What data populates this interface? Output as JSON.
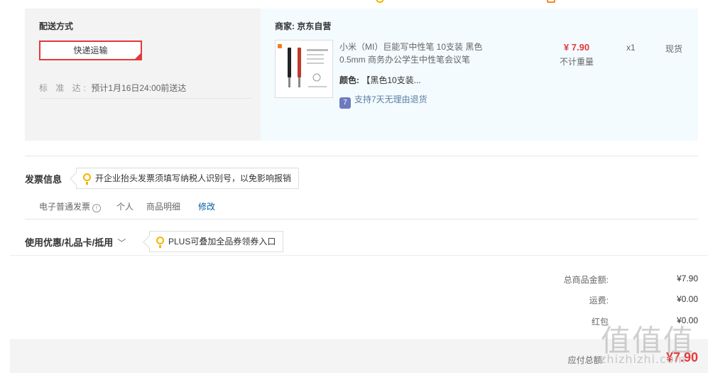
{
  "shipping": {
    "section_title": "配送方式",
    "express_label": "快递运输",
    "standard_label": "标 准 达:",
    "standard_eta": "预计1月16日24:00前送达"
  },
  "merchant": {
    "label": "商家:",
    "name": "京东自营"
  },
  "product": {
    "name": "小米（MI）巨能写中性笔 10支装 黑色0.5mm 商务办公学生中性笔会议笔",
    "color_label": "颜色:",
    "color_value": "【黑色10支装...",
    "return_badge": "7",
    "return_policy": "支持7天无理由退货",
    "price": "¥ 7.90",
    "weight": "不计重量",
    "qty": "x1",
    "stock": "现货"
  },
  "invoice": {
    "title": "发票信息",
    "tip": "开企业抬头发票须填写纳税人识别号，以免影响报销",
    "type": "电子普通发票",
    "info_icon": "info-circle-icon",
    "holder": "个人",
    "content": "商品明细",
    "edit": "修改"
  },
  "coupon": {
    "title": "使用优惠/礼品卡/抵用",
    "tip": "PLUS可叠加全品券领券入口"
  },
  "totals": {
    "goods_label": "总商品金额:",
    "goods_value": "¥7.90",
    "freight_label": "运费:",
    "freight_value": "¥0.00",
    "redpacket_label": "红包",
    "redpacket_value": "¥0.00",
    "payable_label": "应付总额:",
    "payable_value": "¥7.90"
  },
  "watermark": {
    "logo": "值值值",
    "text": "zhizhizhi.com"
  },
  "colors": {
    "accent": "#e4393c",
    "link": "#005ea7",
    "merchant_bg": "#f3fbfe",
    "panel_bg": "#f3f3f3"
  }
}
